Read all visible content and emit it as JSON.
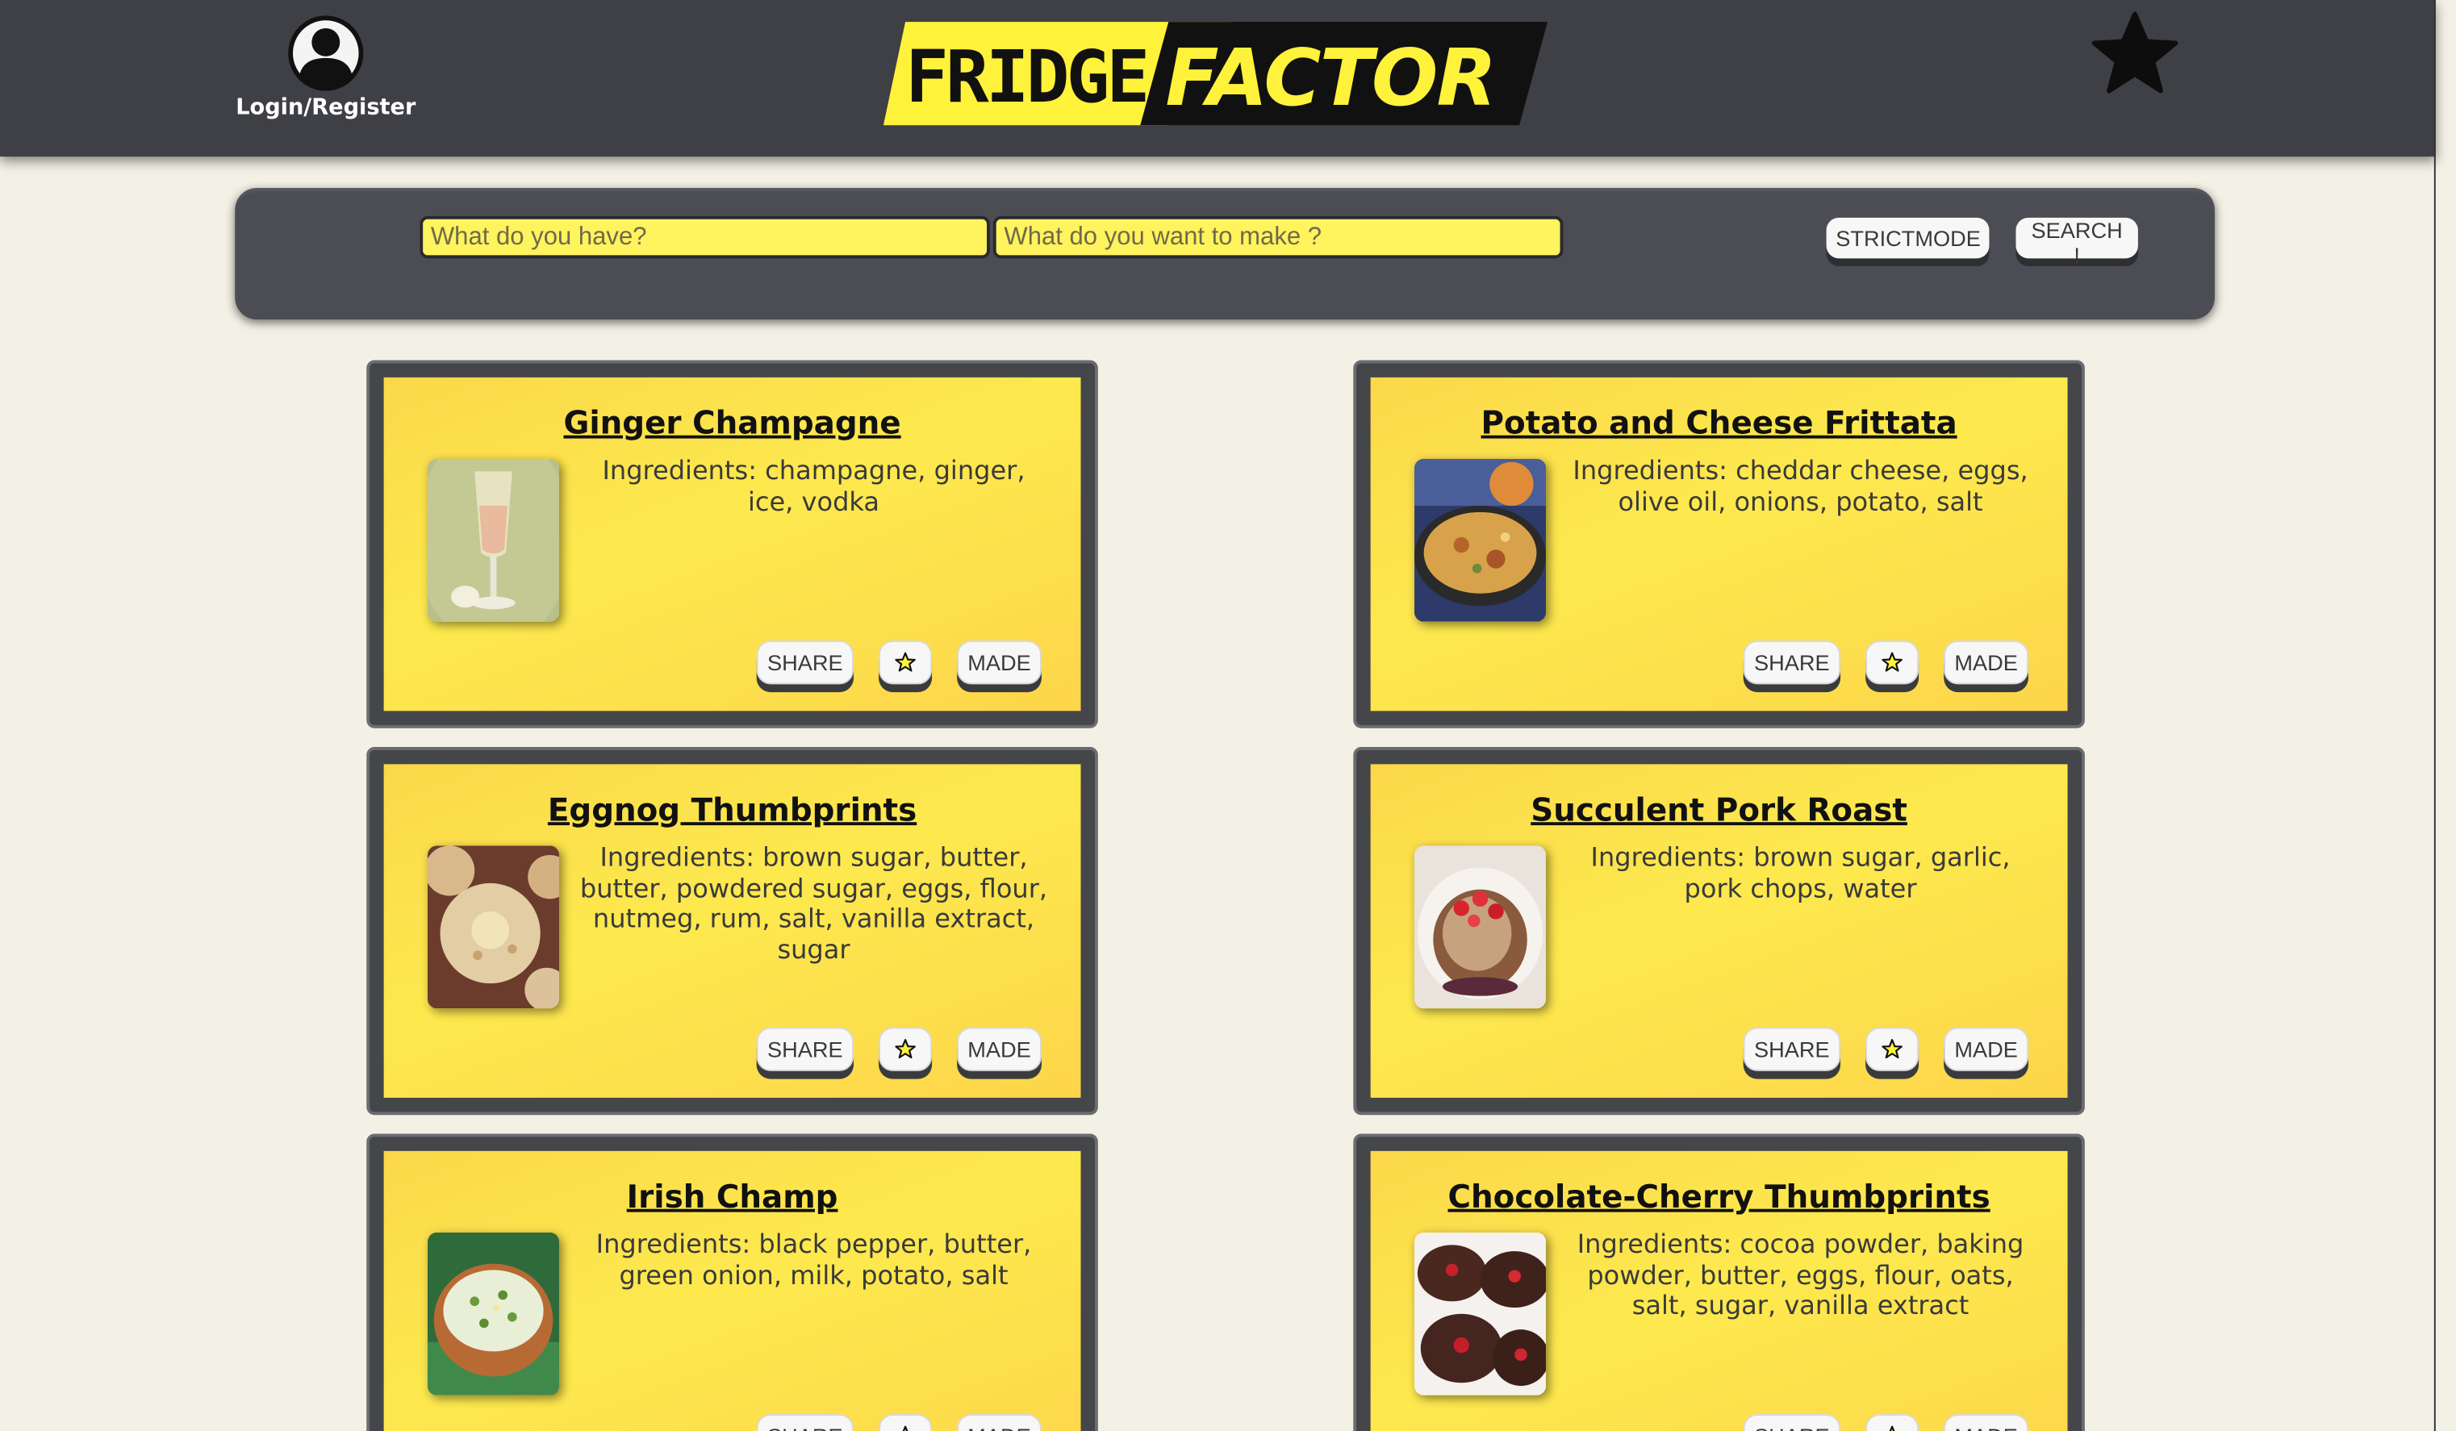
{
  "header": {
    "user_label": "Login/Register",
    "logo_text": {
      "part1": "FRIDGE",
      "part2": "FACTOR"
    },
    "brand_yellow": "#fff23b",
    "header_color": "#3f4045",
    "icons": {
      "user": "user-circle-icon",
      "favorites": "star-icon"
    }
  },
  "search": {
    "have_placeholder": "What do you have?",
    "make_placeholder": "What do you want to make ?",
    "strict_label": "STRICTMODE",
    "search_label": "SEARCH !"
  },
  "card_actions": {
    "share_label": "SHARE",
    "made_label": "MADE",
    "favorite_icon": "star-outline-icon"
  },
  "recipes": [
    {
      "title": "Ginger Champagne",
      "ingredients": "Ingredients: champagne, ginger, ice, vodka"
    },
    {
      "title": "Potato and Cheese Frittata",
      "ingredients": "Ingredients: cheddar cheese, eggs, olive oil, onions, potato, salt"
    },
    {
      "title": "Eggnog Thumbprints",
      "ingredients": "Ingredients: brown sugar, butter, butter, powdered sugar, eggs, flour, nutmeg, rum, salt, vanilla extract, sugar"
    },
    {
      "title": "Succulent Pork Roast",
      "ingredients": "Ingredients: brown sugar, garlic, pork chops, water"
    },
    {
      "title": "Irish Champ",
      "ingredients": "Ingredients: black pepper, butter, green onion, milk, potato, salt"
    },
    {
      "title": "Chocolate-Cherry Thumbprints",
      "ingredients": "Ingredients: cocoa powder, baking powder, butter, eggs, flour, oats, salt, sugar, vanilla extract"
    }
  ]
}
